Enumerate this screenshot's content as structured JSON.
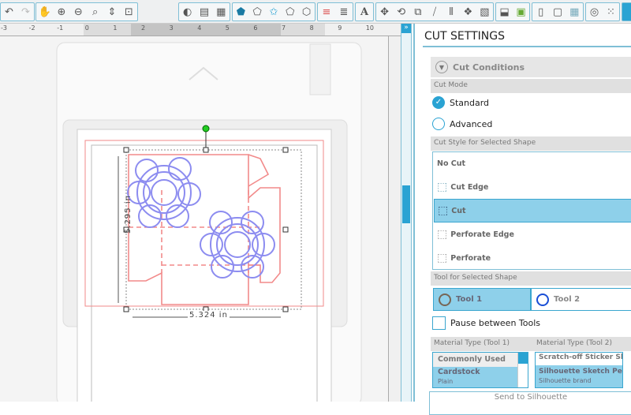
{
  "toolbar": {
    "icons": [
      "undo-icon",
      "redo-icon",
      "pan-hand-icon",
      "zoom-in-icon",
      "zoom-out-icon",
      "zoom-select-icon",
      "drag-zoom-icon",
      "fit-page-icon",
      "fill-color-icon",
      "gradient-icon",
      "fill-pattern-icon",
      "line-color-icon",
      "line-style-icon",
      "line-pattern-icon",
      "trace-icon",
      "sketch-icon",
      "lines-icon",
      "line-weight-icon",
      "text-style-icon",
      "transform-icon",
      "rotate-icon",
      "scale-icon",
      "shear-icon",
      "align-icon",
      "replicate-icon",
      "nest-icon",
      "offset-icon",
      "modify-icon",
      "page-setup-icon",
      "registration-icon",
      "grid-icon",
      "cut-settings-icon",
      "pixscan-icon",
      "send-icon"
    ]
  },
  "ruler": {
    "labels": [
      "-3",
      "-2",
      "-1",
      "0",
      "1",
      "2",
      "3",
      "4",
      "5",
      "6",
      "7",
      "8",
      "9",
      "10"
    ]
  },
  "canvas": {
    "height_label": "5.295 in",
    "width_label": "5.324 in"
  },
  "panel": {
    "title": "CUT SETTINGS",
    "conditions_label": "Cut Conditions",
    "cut_mode_label": "Cut Mode",
    "modes": [
      {
        "label": "Standard",
        "checked": true
      },
      {
        "label": "Advanced",
        "checked": false
      }
    ],
    "cut_style_label": "Cut Style for Selected Shape",
    "styles": [
      {
        "label": "No Cut"
      },
      {
        "label": "Cut Edge"
      },
      {
        "label": "Cut",
        "selected": true
      },
      {
        "label": "Perforate Edge"
      },
      {
        "label": "Perforate"
      }
    ],
    "tool_label": "Tool for Selected Shape",
    "tools": [
      {
        "label": "Tool 1",
        "selected": true
      },
      {
        "label": "Tool 2"
      }
    ],
    "pause_label": "Pause between Tools",
    "mat1_label": "Material Type (Tool 1)",
    "mat2_label": "Material Type (Tool 2)",
    "mat1_items": [
      {
        "label": "Commonly Used"
      },
      {
        "label": "Cardstock",
        "sub": "Plain"
      }
    ],
    "mat2_items": [
      {
        "label": "Scratch-off Sticker Sheet"
      },
      {
        "label": "Silhouette Sketch Pen",
        "sub": "Silhouette brand"
      }
    ],
    "send_label": "Send to Silhouette"
  },
  "colors": {
    "accent": "#2aa3d3",
    "cut_line": "#f28a8a",
    "shape": "#8c8cf0"
  }
}
